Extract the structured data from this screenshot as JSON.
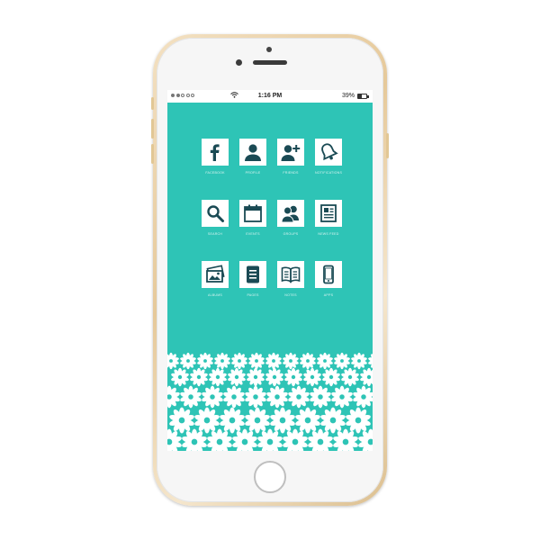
{
  "device": {
    "frame_color": "#e8cfa2",
    "screen_color": "#2ec4b6"
  },
  "status_bar": {
    "signal_dots": 5,
    "time": "1:16 PM",
    "battery_percent": "39%"
  },
  "apps": [
    {
      "label": "FACEBOOK",
      "icon": "facebook-icon"
    },
    {
      "label": "PROFILE",
      "icon": "profile-icon"
    },
    {
      "label": "FRIENDS",
      "icon": "add-friend-icon"
    },
    {
      "label": "NOTIFICATIONS",
      "icon": "bell-icon"
    },
    {
      "label": "SEARCH",
      "icon": "search-icon"
    },
    {
      "label": "EVENTS",
      "icon": "calendar-icon"
    },
    {
      "label": "GROUPS",
      "icon": "groups-icon"
    },
    {
      "label": "NEWS FEED",
      "icon": "news-feed-icon"
    },
    {
      "label": "ALBUMS",
      "icon": "photo-album-icon"
    },
    {
      "label": "PAGES",
      "icon": "pages-icon"
    },
    {
      "label": "NOTES",
      "icon": "notes-book-icon"
    },
    {
      "label": "APPS",
      "icon": "phone-icon"
    }
  ],
  "wallpaper": {
    "pattern": "white-lace-flowers"
  }
}
